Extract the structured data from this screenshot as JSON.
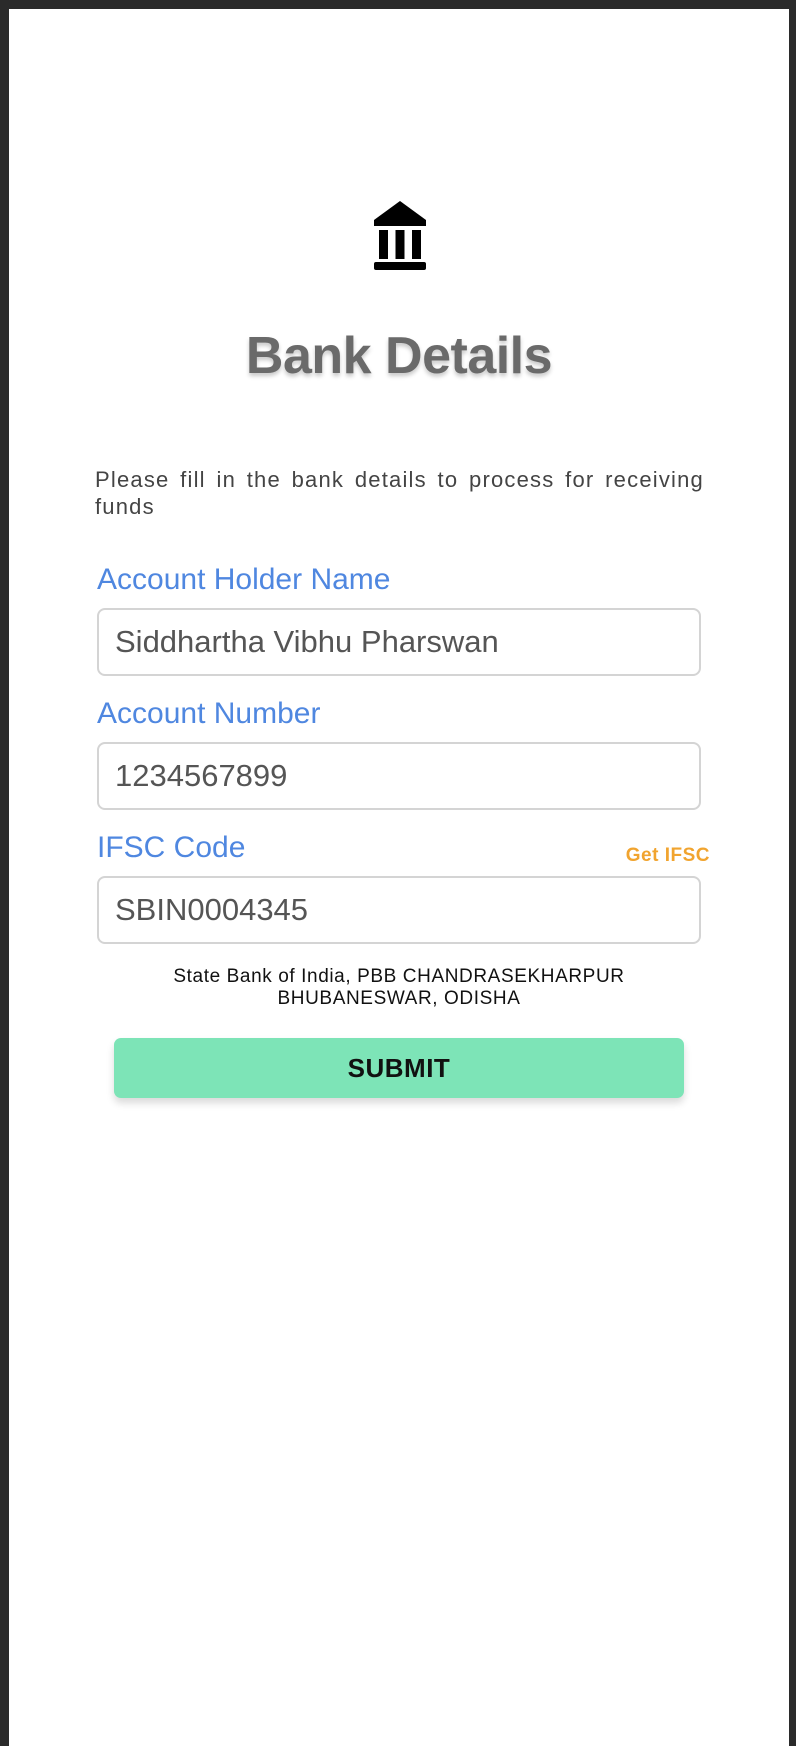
{
  "page": {
    "title": "Bank Details",
    "intro": "Please fill in the bank details to process for receiving funds",
    "icon": "bank-icon"
  },
  "form": {
    "account_holder": {
      "label": "Account Holder Name",
      "value": "Siddhartha Vibhu Pharswan"
    },
    "account_number": {
      "label": "Account Number",
      "value": "1234567899"
    },
    "ifsc": {
      "label": "IFSC Code",
      "value": "SBIN0004345",
      "lookup_link": "Get IFSC"
    },
    "bank_branch": {
      "line1": "State Bank of India, PBB CHANDRASEKHARPUR",
      "line2": "BHUBANESWAR, ODISHA"
    },
    "submit_label": "SUBMIT"
  },
  "colors": {
    "label": "#4f87e0",
    "link": "#f1a42f",
    "submit_bg": "#7de4b7",
    "title": "#6a6a6a"
  }
}
